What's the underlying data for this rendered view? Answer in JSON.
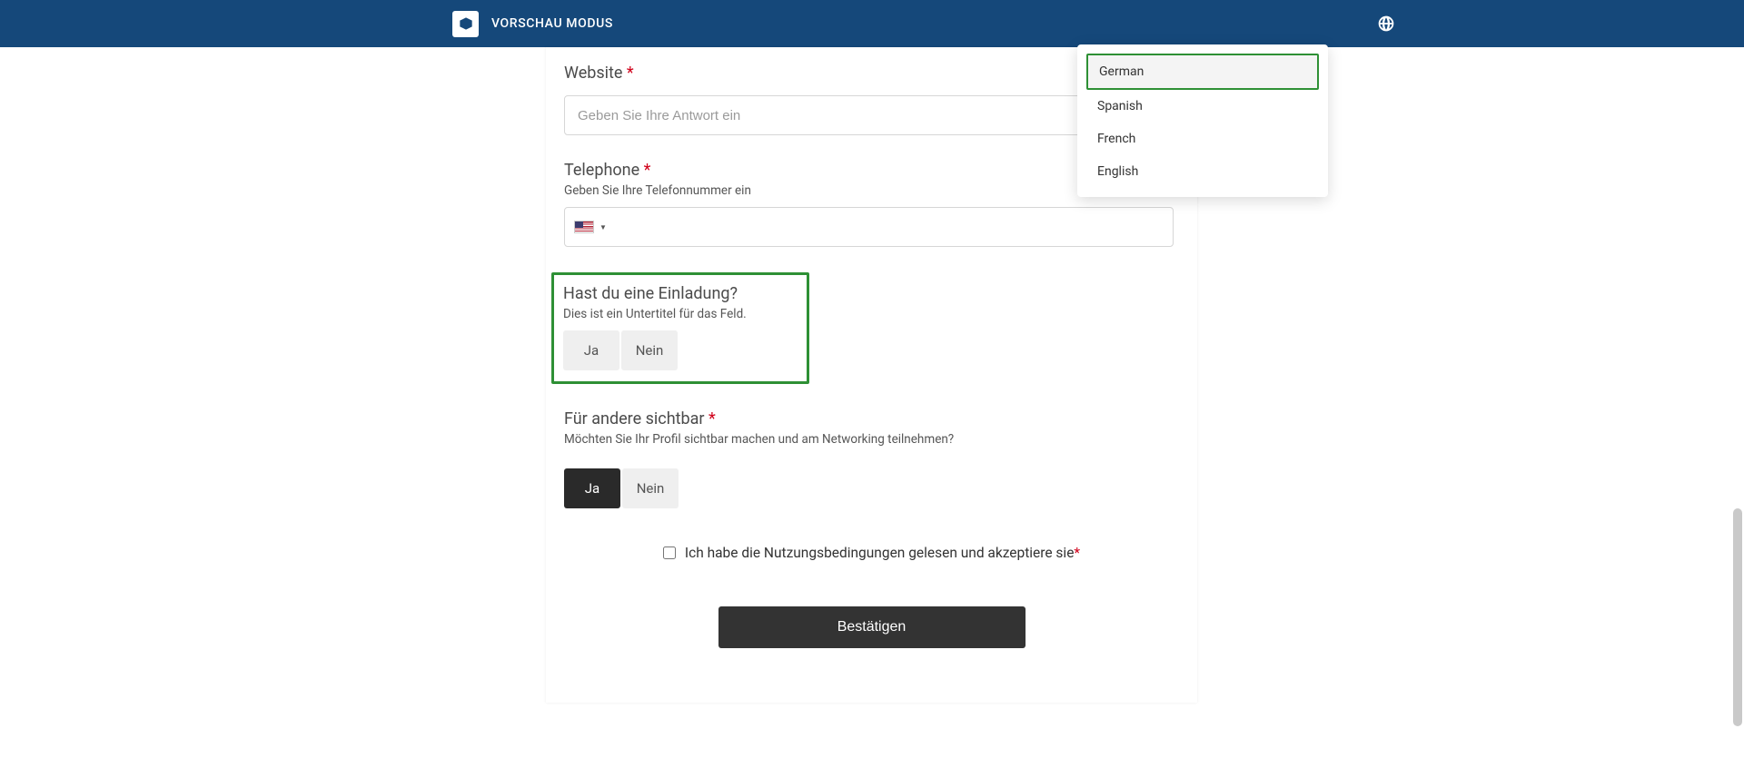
{
  "header": {
    "preview_mode": "VORSCHAU MODUS"
  },
  "lang_menu": {
    "items": [
      {
        "label": "German",
        "selected": true
      },
      {
        "label": "Spanish",
        "selected": false
      },
      {
        "label": "French",
        "selected": false
      },
      {
        "label": "English",
        "selected": false
      }
    ]
  },
  "fields": {
    "website": {
      "label": "Website",
      "placeholder": "Geben Sie Ihre Antwort ein"
    },
    "telephone": {
      "label": "Telephone",
      "subtitle": "Geben Sie Ihre Telefonnummer ein"
    },
    "invitation": {
      "label": "Hast du eine Einladung?",
      "subtitle": "Dies ist ein Untertitel für das Feld.",
      "yes": "Ja",
      "no": "Nein"
    },
    "visible": {
      "label": "Für andere sichtbar",
      "subtitle": "Möchten Sie Ihr Profil sichtbar machen und am Networking teilnehmen?",
      "yes": "Ja",
      "no": "Nein"
    }
  },
  "terms": {
    "text": "Ich habe die Nutzungsbedingungen gelesen und akzeptiere sie"
  },
  "actions": {
    "confirm": "Bestätigen"
  },
  "required_marker": "*"
}
